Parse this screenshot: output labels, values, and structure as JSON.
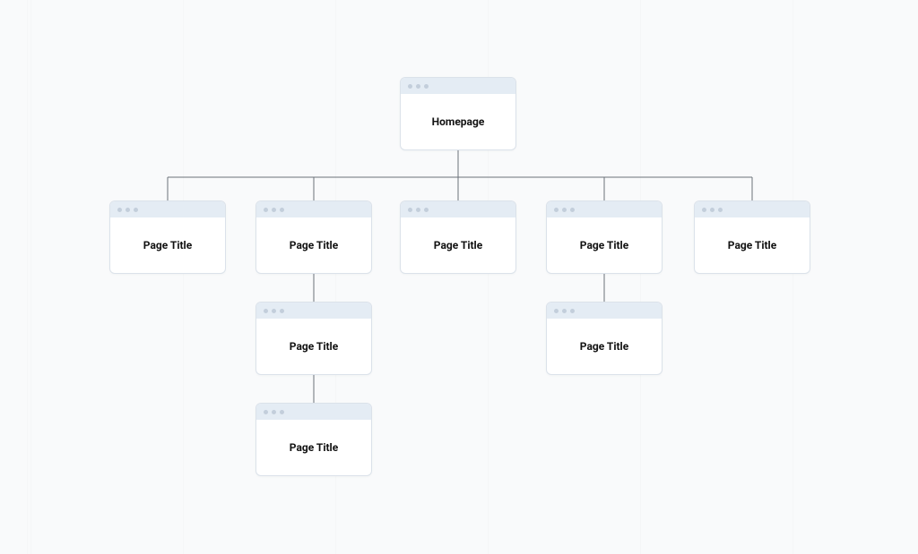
{
  "colors": {
    "page_bg": "#f9fafb",
    "node_bg": "#ffffff",
    "node_border": "#dbe2ea",
    "node_header_bg": "#e4ecf4",
    "dot": "#c3cedb",
    "connector": "#6a717a",
    "text": "#111111"
  },
  "nodes": {
    "root": {
      "title": "Homepage"
    },
    "row1": [
      {
        "title": "Page Title"
      },
      {
        "title": "Page Title"
      },
      {
        "title": "Page Title"
      },
      {
        "title": "Page Title"
      },
      {
        "title": "Page Title"
      }
    ],
    "row2": {
      "col1": {
        "title": "Page Title"
      },
      "col3": {
        "title": "Page Title"
      }
    },
    "row3": {
      "col1": {
        "title": "Page Title"
      }
    }
  }
}
